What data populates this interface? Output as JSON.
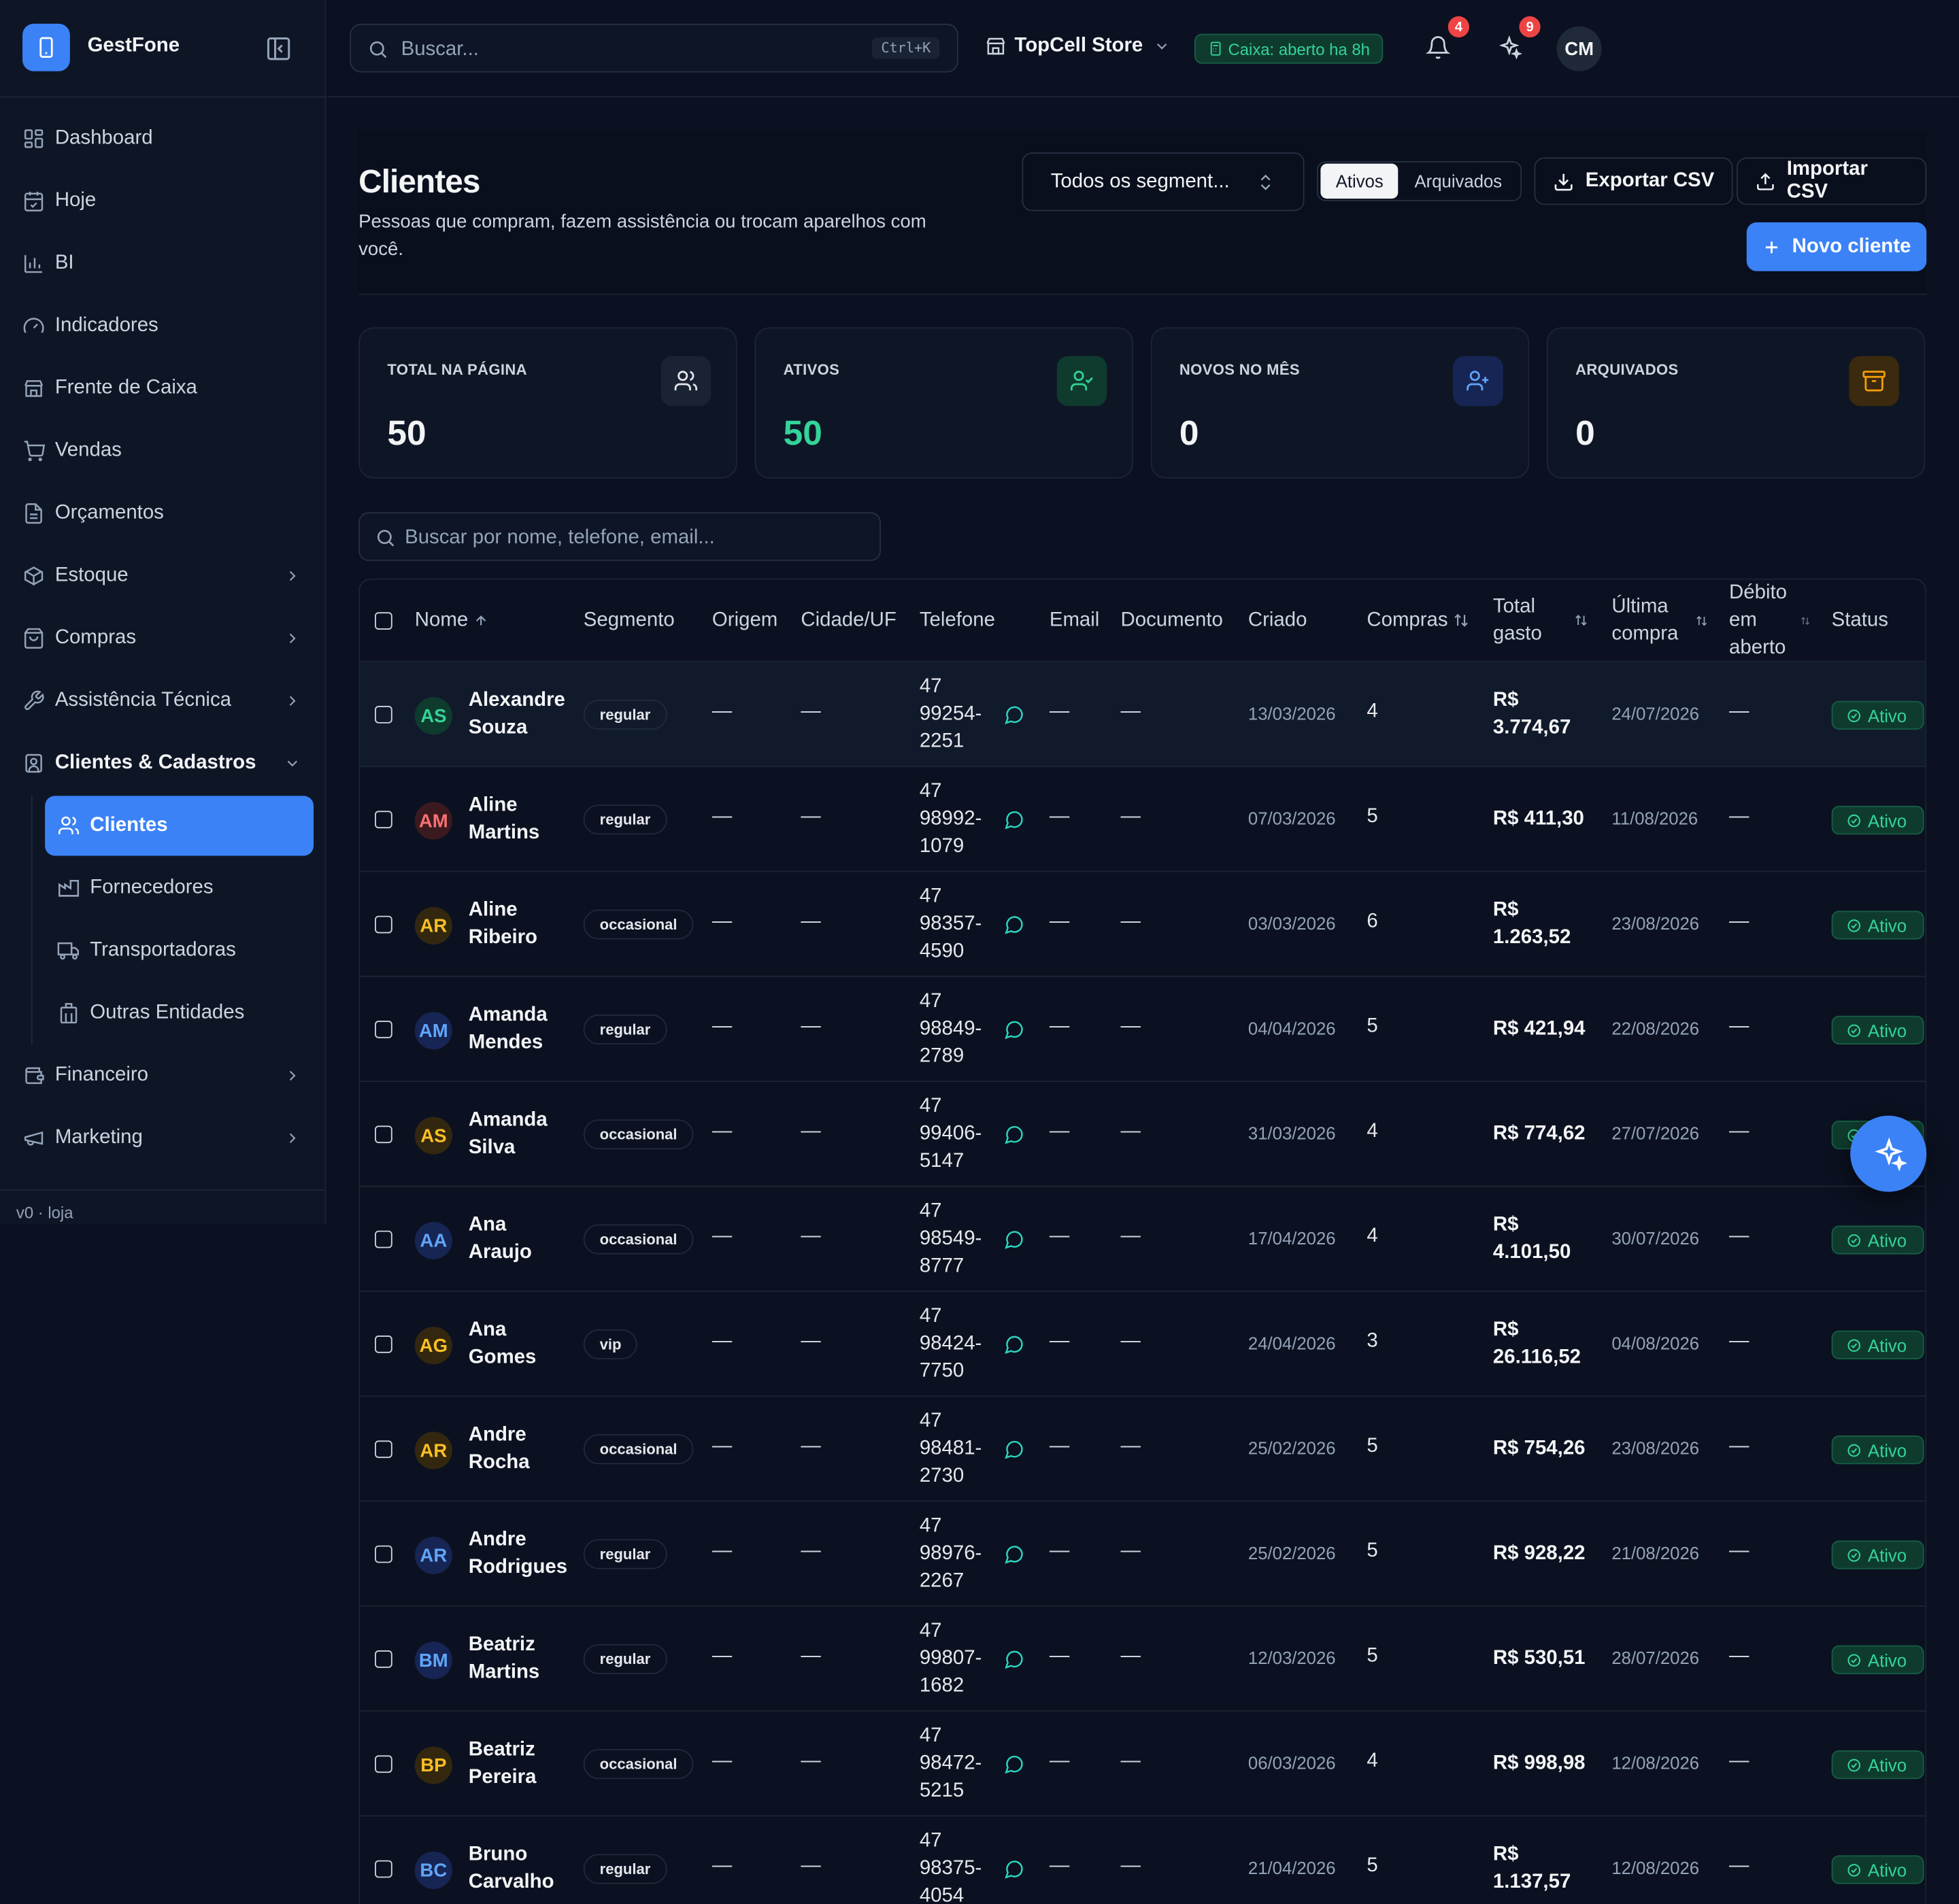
{
  "app": {
    "name": "GestFone",
    "version": "v0 · loja"
  },
  "sidebar": {
    "items": [
      {
        "label": "Dashboard",
        "icon": "grid-icon"
      },
      {
        "label": "Hoje",
        "icon": "calendar-icon"
      },
      {
        "label": "BI",
        "icon": "bar-chart-icon"
      },
      {
        "label": "Indicadores",
        "icon": "gauge-icon"
      },
      {
        "label": "Frente de Caixa",
        "icon": "store-icon"
      },
      {
        "label": "Vendas",
        "icon": "cart-icon"
      },
      {
        "label": "Orçamentos",
        "icon": "file-icon"
      },
      {
        "label": "Estoque",
        "icon": "box-icon",
        "chevron": true
      },
      {
        "label": "Compras",
        "icon": "bag-icon",
        "chevron": true
      },
      {
        "label": "Assistência Técnica",
        "icon": "wrench-icon",
        "chevron": true
      },
      {
        "label": "Clientes & Cadastros",
        "icon": "contact-icon",
        "chevron": true,
        "open": true
      },
      {
        "label": "Financeiro",
        "icon": "wallet-icon",
        "chevron": true
      },
      {
        "label": "Marketing",
        "icon": "megaphone-icon",
        "chevron": true
      }
    ],
    "sub_items": [
      {
        "label": "Clientes",
        "icon": "users-icon",
        "active": true
      },
      {
        "label": "Fornecedores",
        "icon": "factory-icon"
      },
      {
        "label": "Transportadoras",
        "icon": "truck-icon"
      },
      {
        "label": "Outras Entidades",
        "icon": "building-icon"
      }
    ]
  },
  "topbar": {
    "search_placeholder": "Buscar...",
    "shortcut": "Ctrl+K",
    "store": "TopCell Store",
    "caixa": "Caixa: aberto ha 8h",
    "notifications": "4",
    "ai_badge": "9",
    "user_initials": "CM"
  },
  "page": {
    "title": "Clientes",
    "subtitle": "Pessoas que compram, fazem assistência ou trocam aparelhos com você.",
    "segment_select": "Todos os segment...",
    "toggle_active": "Ativos",
    "toggle_archived": "Arquivados",
    "export_label": "Exportar CSV",
    "import_label": "Importar CSV",
    "new_label": "Novo cliente"
  },
  "stats": [
    {
      "label": "TOTAL NA PÁGINA",
      "value": "50",
      "color": "#f3f4f6",
      "icon": "users-icon",
      "icon_bg": "#1a2334",
      "icon_color": "#e5e7eb"
    },
    {
      "label": "ATIVOS",
      "value": "50",
      "color": "#34d399",
      "icon": "user-check-icon",
      "icon_bg": "#0f3b2e",
      "icon_color": "#34d399"
    },
    {
      "label": "NOVOS NO MÊS",
      "value": "0",
      "color": "#f3f4f6",
      "icon": "user-plus-icon",
      "icon_bg": "#172554",
      "icon_color": "#60a5fa"
    },
    {
      "label": "ARQUIVADOS",
      "value": "0",
      "color": "#f3f4f6",
      "icon": "archive-icon",
      "icon_bg": "#3b2a0e",
      "icon_color": "#f59e0b"
    }
  ],
  "table": {
    "search_placeholder": "Buscar por nome, telefone, email...",
    "columns": {
      "nome": "Nome",
      "segmento": "Segmento",
      "origem": "Origem",
      "cidade": "Cidade/UF",
      "telefone": "Telefone",
      "email": "Email",
      "documento": "Documento",
      "criado": "Criado",
      "compras": "Compras",
      "total_a": "Total",
      "total_b": "gasto",
      "ultima_a": "Última",
      "ultima_b": "compra",
      "debito_a": "Débito",
      "debito_b": "em",
      "debito_c": "aberto",
      "status": "Status"
    },
    "empty": "—",
    "rows": [
      {
        "initials": "AS",
        "first": "Alexandre",
        "last": "Souza",
        "segment": "regular",
        "p1": "47",
        "p2": "99254-",
        "p3": "2251",
        "created": "13/03/2026",
        "purchases": "4",
        "t1": "R$",
        "t2": "3.774,67",
        "last_purchase": "24/07/2026",
        "status": "Ativo",
        "av_color": "#34d399",
        "av_bg": "#0f3b2e"
      },
      {
        "initials": "AM",
        "first": "Aline",
        "last": "Martins",
        "segment": "regular",
        "p1": "47",
        "p2": "98992-",
        "p3": "1079",
        "created": "07/03/2026",
        "purchases": "5",
        "t1": "R$ 411,30",
        "t2": "",
        "last_purchase": "11/08/2026",
        "status": "Ativo",
        "av_color": "#f87171",
        "av_bg": "#3b1a1f"
      },
      {
        "initials": "AR",
        "first": "Aline",
        "last": "Ribeiro",
        "segment": "occasional",
        "p1": "47",
        "p2": "98357-",
        "p3": "4590",
        "created": "03/03/2026",
        "purchases": "6",
        "t1": "R$",
        "t2": "1.263,52",
        "last_purchase": "23/08/2026",
        "status": "Ativo",
        "av_color": "#fbbf24",
        "av_bg": "#33280f"
      },
      {
        "initials": "AM",
        "first": "Amanda",
        "last": "Mendes",
        "segment": "regular",
        "p1": "47",
        "p2": "98849-",
        "p3": "2789",
        "created": "04/04/2026",
        "purchases": "5",
        "t1": "R$ 421,94",
        "t2": "",
        "last_purchase": "22/08/2026",
        "status": "Ativo",
        "av_color": "#60a5fa",
        "av_bg": "#172554"
      },
      {
        "initials": "AS",
        "first": "Amanda",
        "last": "Silva",
        "segment": "occasional",
        "p1": "47",
        "p2": "99406-",
        "p3": "5147",
        "created": "31/03/2026",
        "purchases": "4",
        "t1": "R$ 774,62",
        "t2": "",
        "last_purchase": "27/07/2026",
        "status": "Ativo",
        "av_color": "#fbbf24",
        "av_bg": "#33280f"
      },
      {
        "initials": "AA",
        "first": "Ana",
        "last": "Araujo",
        "segment": "occasional",
        "p1": "47",
        "p2": "98549-",
        "p3": "8777",
        "created": "17/04/2026",
        "purchases": "4",
        "t1": "R$",
        "t2": "4.101,50",
        "last_purchase": "30/07/2026",
        "status": "Ativo",
        "av_color": "#60a5fa",
        "av_bg": "#172554"
      },
      {
        "initials": "AG",
        "first": "Ana",
        "last": "Gomes",
        "segment": "vip",
        "p1": "47",
        "p2": "98424-",
        "p3": "7750",
        "created": "24/04/2026",
        "purchases": "3",
        "t1": "R$",
        "t2": "26.116,52",
        "last_purchase": "04/08/2026",
        "status": "Ativo",
        "av_color": "#fbbf24",
        "av_bg": "#33280f"
      },
      {
        "initials": "AR",
        "first": "Andre",
        "last": "Rocha",
        "segment": "occasional",
        "p1": "47",
        "p2": "98481-",
        "p3": "2730",
        "created": "25/02/2026",
        "purchases": "5",
        "t1": "R$ 754,26",
        "t2": "",
        "last_purchase": "23/08/2026",
        "status": "Ativo",
        "av_color": "#fbbf24",
        "av_bg": "#33280f"
      },
      {
        "initials": "AR",
        "first": "Andre",
        "last": "Rodrigues",
        "segment": "regular",
        "p1": "47",
        "p2": "98976-",
        "p3": "2267",
        "created": "25/02/2026",
        "purchases": "5",
        "t1": "R$ 928,22",
        "t2": "",
        "last_purchase": "21/08/2026",
        "status": "Ativo",
        "av_color": "#60a5fa",
        "av_bg": "#172554"
      },
      {
        "initials": "BM",
        "first": "Beatriz",
        "last": "Martins",
        "segment": "regular",
        "p1": "47",
        "p2": "99807-",
        "p3": "1682",
        "created": "12/03/2026",
        "purchases": "5",
        "t1": "R$ 530,51",
        "t2": "",
        "last_purchase": "28/07/2026",
        "status": "Ativo",
        "av_color": "#60a5fa",
        "av_bg": "#172554"
      },
      {
        "initials": "BP",
        "first": "Beatriz",
        "last": "Pereira",
        "segment": "occasional",
        "p1": "47",
        "p2": "98472-",
        "p3": "5215",
        "created": "06/03/2026",
        "purchases": "4",
        "t1": "R$ 998,98",
        "t2": "",
        "last_purchase": "12/08/2026",
        "status": "Ativo",
        "av_color": "#fbbf24",
        "av_bg": "#33280f"
      },
      {
        "initials": "BC",
        "first": "Bruno",
        "last": "Carvalho",
        "segment": "regular",
        "p1": "47",
        "p2": "98375-",
        "p3": "4054",
        "created": "21/04/2026",
        "purchases": "5",
        "t1": "R$",
        "t2": "1.137,57",
        "last_purchase": "12/08/2026",
        "status": "Ativo",
        "av_color": "#60a5fa",
        "av_bg": "#172554"
      }
    ]
  },
  "colors": {
    "accent": "#3b82f6",
    "success": "#34d399",
    "background": "#0b1120"
  }
}
